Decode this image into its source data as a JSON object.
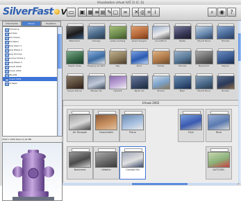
{
  "window": {
    "title": "Visualisation virtual (VLT 2) (C: G)",
    "logo_text": "SilverFast",
    "logo_suffix": "VLT"
  },
  "toolbar": {
    "buttons": [
      {
        "name": "save-icon",
        "glyph": "▭"
      },
      {
        "name": "monitor-icon",
        "glyph": "▣"
      },
      {
        "name": "grid-view-icon",
        "glyph": "▦"
      },
      {
        "name": "list-view-icon",
        "glyph": "≡"
      },
      {
        "name": "thumbs-view-icon",
        "glyph": "▤"
      },
      {
        "name": "edit-icon",
        "glyph": "✎"
      },
      {
        "name": "delete-icon",
        "glyph": "▢"
      },
      {
        "name": "binoculars-icon",
        "glyph": "∞"
      },
      {
        "name": "close-icon",
        "glyph": "✕"
      },
      {
        "name": "target-icon",
        "glyph": "◎"
      },
      {
        "name": "crop-icon",
        "glyph": "⌗"
      },
      {
        "name": "info-icon",
        "glyph": "i"
      }
    ],
    "right_buttons": [
      {
        "name": "search-icon",
        "glyph": "⌕"
      },
      {
        "name": "settings-icon",
        "glyph": "◉"
      },
      {
        "name": "help-icon",
        "glyph": "?"
      }
    ]
  },
  "sidebar": {
    "tabs": [
      "Dokumente",
      "Album",
      "Projektion"
    ],
    "active_tab": 1,
    "tree": [
      {
        "label": "Photoshop",
        "selected": false
      },
      {
        "label": "Bild Fahr",
        "selected": false
      },
      {
        "label": "Bild Urlaub",
        "selected": false
      },
      {
        "label": "Bild Natur",
        "selected": false
      },
      {
        "label": "Berg Alpen 1",
        "selected": false
      },
      {
        "label": "Berg Wiese 2",
        "selected": false
      },
      {
        "label": "Berg Himmel",
        "selected": false
      },
      {
        "label": "Himmel Türkis 1",
        "selected": false
      },
      {
        "label": "Berg Wiese 3",
        "selected": false
      },
      {
        "label": "Urlaub Stadt",
        "selected": false
      },
      {
        "label": "Urlaub 2002",
        "selected": false
      },
      {
        "label": "URLAUB",
        "selected": false
      },
      {
        "label": "Urlaub 2002",
        "selected": true
      },
      {
        "label": "Vorlagen",
        "selected": false
      }
    ],
    "image_info": "2000 x 1500 Pixel 11,44 MB"
  },
  "grid": {
    "rows": [
      [
        {
          "label": "Bildschirm",
          "colors": [
            "#1b1b1b",
            "#6a6a6a",
            "#3a5a80"
          ]
        },
        {
          "label": "Chicago",
          "colors": [
            "#4a6a8a",
            "#9ab0c8",
            "#2a3a4a"
          ]
        },
        {
          "label": "erste Landung",
          "colors": [
            "#6f8d4e",
            "#a5c07a",
            "#3d5228"
          ]
        },
        {
          "label": "Grand Canyon",
          "colors": [
            "#b86a3a",
            "#e0a070",
            "#7a3a1a"
          ]
        },
        {
          "label": "Grundform",
          "colors": [
            "#eaeaea",
            "#9ab0d0",
            "#555555"
          ]
        },
        {
          "label": "Wüste",
          "colors": [
            "#3a3a5a",
            "#7a7a9a",
            "#1a1a2a"
          ]
        },
        {
          "label": "Mount Hood",
          "colors": [
            "#6a8ab0",
            "#c0d0e0",
            "#2a4060"
          ]
        },
        {
          "label": "Himmel",
          "colors": [
            "#4a6a9a",
            "#8aa8d0",
            "#2a3a5a"
          ]
        }
      ],
      [
        {
          "label": "Hawaii Küste",
          "colors": [
            "#3a6a4a",
            "#7aaa8a",
            "#1a3a2a"
          ]
        },
        {
          "label": "Eingang am Wolf",
          "colors": [
            "#3a6aa0",
            "#8ab0e0",
            "#e8e8e8"
          ]
        },
        {
          "label": "Kap",
          "colors": [
            "#8a7a5a",
            "#c0b090",
            "#4a3a2a"
          ]
        },
        {
          "label": "Fjord",
          "colors": [
            "#2a5ab0",
            "#7aa0e0",
            "#c0d8f8"
          ]
        },
        {
          "label": "Flanke",
          "colors": [
            "#b07a4a",
            "#e0b080",
            "#6a4a2a"
          ]
        },
        {
          "label": "Himmel",
          "colors": [
            "#5a7a9a",
            "#9ab0c8",
            "#2a3a4a"
          ]
        },
        {
          "label": "Bauschild",
          "colors": [
            "#6a6a6a",
            "#aaaaaa",
            "#3a3a3a"
          ]
        },
        {
          "label": "Skyline",
          "colors": [
            "#3a5a90",
            "#6a8ac0",
            "#1a2a4a"
          ]
        }
      ],
      [
        {
          "label": "Kanye Toolcar",
          "colors": [
            "#5a4a3a",
            "#8a7a6a",
            "#2a1a1a"
          ]
        },
        {
          "label": "Mauser AS",
          "colors": [
            "#c0c8d8",
            "#8090a8",
            "#3a4a5a"
          ]
        },
        {
          "label": "Hydrant",
          "colors": [
            "#c0a8d8",
            "#8a6ab0",
            "#f0f0f0"
          ]
        },
        {
          "label": "Berlin AA",
          "colors": [
            "#3a4a6a",
            "#6a7a9a",
            "#1a2a3a"
          ]
        },
        {
          "label": "Strand",
          "colors": [
            "#7aa0c8",
            "#c8d8e8",
            "#8a7a5a"
          ]
        },
        {
          "label": "Meer",
          "colors": [
            "#3a5a80",
            "#6a8ab0",
            "#1a2a4a"
          ]
        },
        {
          "label": "Mount Hood",
          "colors": [
            "#4a6a8a",
            "#8aa0b8",
            "#2a3a4a"
          ]
        },
        {
          "label": "Brücke",
          "colors": [
            "#2a3a5a",
            "#5a6a8a",
            "#8a6a4a"
          ]
        }
      ]
    ]
  },
  "album": {
    "title": "Urlaub 2002",
    "items": [
      {
        "label": "Air Tonopah",
        "colors": [
          "#d8d8d8",
          "#a0a0a0",
          "#4a4a4a"
        ],
        "selected": false
      },
      {
        "label": "Chopinstein",
        "colors": [
          "#c89060",
          "#8a5a3a",
          "#e0c0a0"
        ],
        "selected": false
      },
      {
        "label": "Plane",
        "colors": [
          "#a8c0e0",
          "#6a8ab0",
          "#e8e8e8"
        ],
        "selected": false
      },
      {
        "label": "Flyin",
        "colors": [
          "#3a5ab0",
          "#7aa0e0",
          "#c0c0c0"
        ],
        "selected": false
      },
      {
        "label": "Blue",
        "colors": [
          "#5a7ab0",
          "#9ab0d8",
          "#d8d8d8"
        ],
        "selected": false
      },
      {
        "label": "Naturtest",
        "colors": [
          "#4a4a4a",
          "#9a9a9a",
          "#d0d0d0"
        ],
        "selected": false
      },
      {
        "label": "Uebahn",
        "colors": [
          "#6a6a6a",
          "#aaaaaa",
          "#3a3a3a"
        ],
        "selected": false
      },
      {
        "label": "Cockpit Kfz",
        "colors": [
          "#e0e0e0",
          "#a0a8b8",
          "#3a4a6a"
        ],
        "selected": true
      },
      {
        "label": "AUTOGRL",
        "colors": [
          "#8ab07a",
          "#c8d8b0",
          "#d04040"
        ],
        "selected": false
      }
    ]
  },
  "colors": {
    "selection": "#3d74d6",
    "logo_blue": "#2f5fb0",
    "scroll_blue": "#5a8ce0"
  }
}
